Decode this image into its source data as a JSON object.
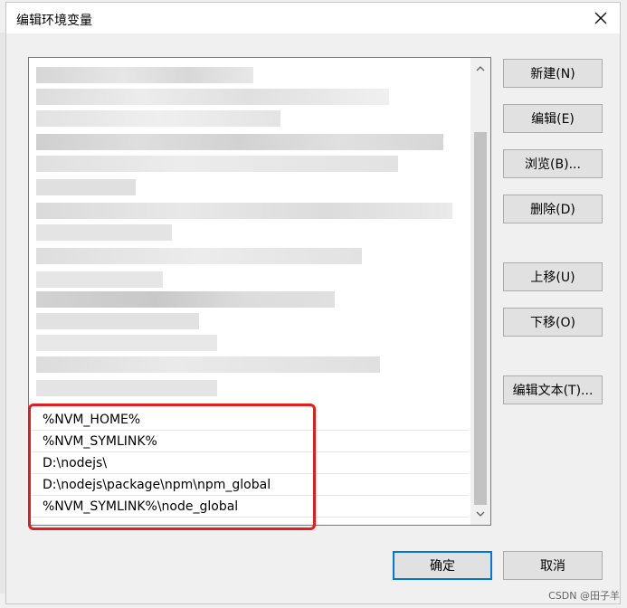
{
  "dialog": {
    "title": "编辑环境变量"
  },
  "list": {
    "items": [
      "%NVM_HOME%",
      "%NVM_SYMLINK%",
      "D:\\nodejs\\",
      "D:\\nodejs\\package\\npm\\npm_global",
      "%NVM_SYMLINK%\\node_global"
    ]
  },
  "buttons": {
    "new": "新建(N)",
    "edit": "编辑(E)",
    "browse": "浏览(B)...",
    "delete": "删除(D)",
    "move_up": "上移(U)",
    "move_down": "下移(O)",
    "edit_text": "编辑文本(T)...",
    "ok": "确定",
    "cancel": "取消"
  },
  "watermark": "CSDN @田子羊",
  "colors": {
    "highlight": "#e11e1e",
    "focus": "#0078d7"
  },
  "icons": {
    "close": "close-icon",
    "scroll_up": "chevron-up-icon",
    "scroll_down": "chevron-down-icon"
  }
}
